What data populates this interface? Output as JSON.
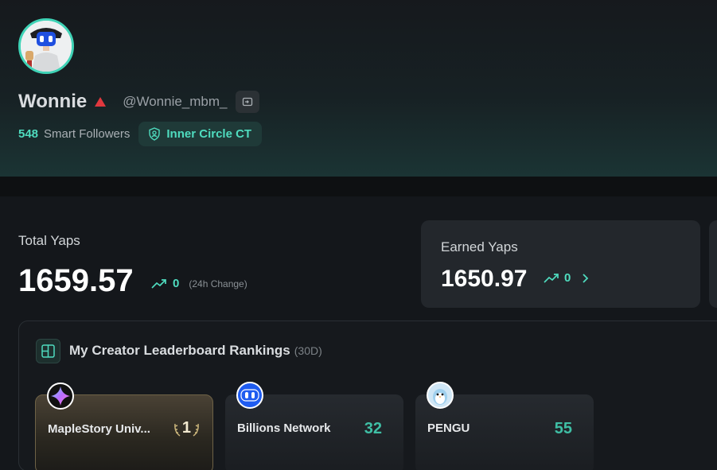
{
  "profile": {
    "display_name": "Wonnie",
    "handle": "@Wonnie_mbm_",
    "smart_followers_count": "548",
    "smart_followers_label": "Smart Followers",
    "badge_label": "Inner Circle CT"
  },
  "stats": {
    "total_label": "Total Yaps",
    "total_value": "1659.57",
    "total_change": "0",
    "total_change_caption": "(24h Change)",
    "earned_label": "Earned Yaps",
    "earned_value": "1650.97",
    "earned_change": "0"
  },
  "leaderboard": {
    "title": "My Creator Leaderboard Rankings",
    "period": "(30D)",
    "rankings": [
      {
        "project": "MapleStory Univ...",
        "rank": "1",
        "logo": "maplestory-logo"
      },
      {
        "project": "Billions Network",
        "rank": "32",
        "logo": "billions-logo"
      },
      {
        "project": "PENGU",
        "rank": "55",
        "logo": "pengu-logo"
      }
    ]
  },
  "colors": {
    "accent": "#4fdcbf",
    "gold": "#f3ead0",
    "rank_up": "#e0383e"
  }
}
